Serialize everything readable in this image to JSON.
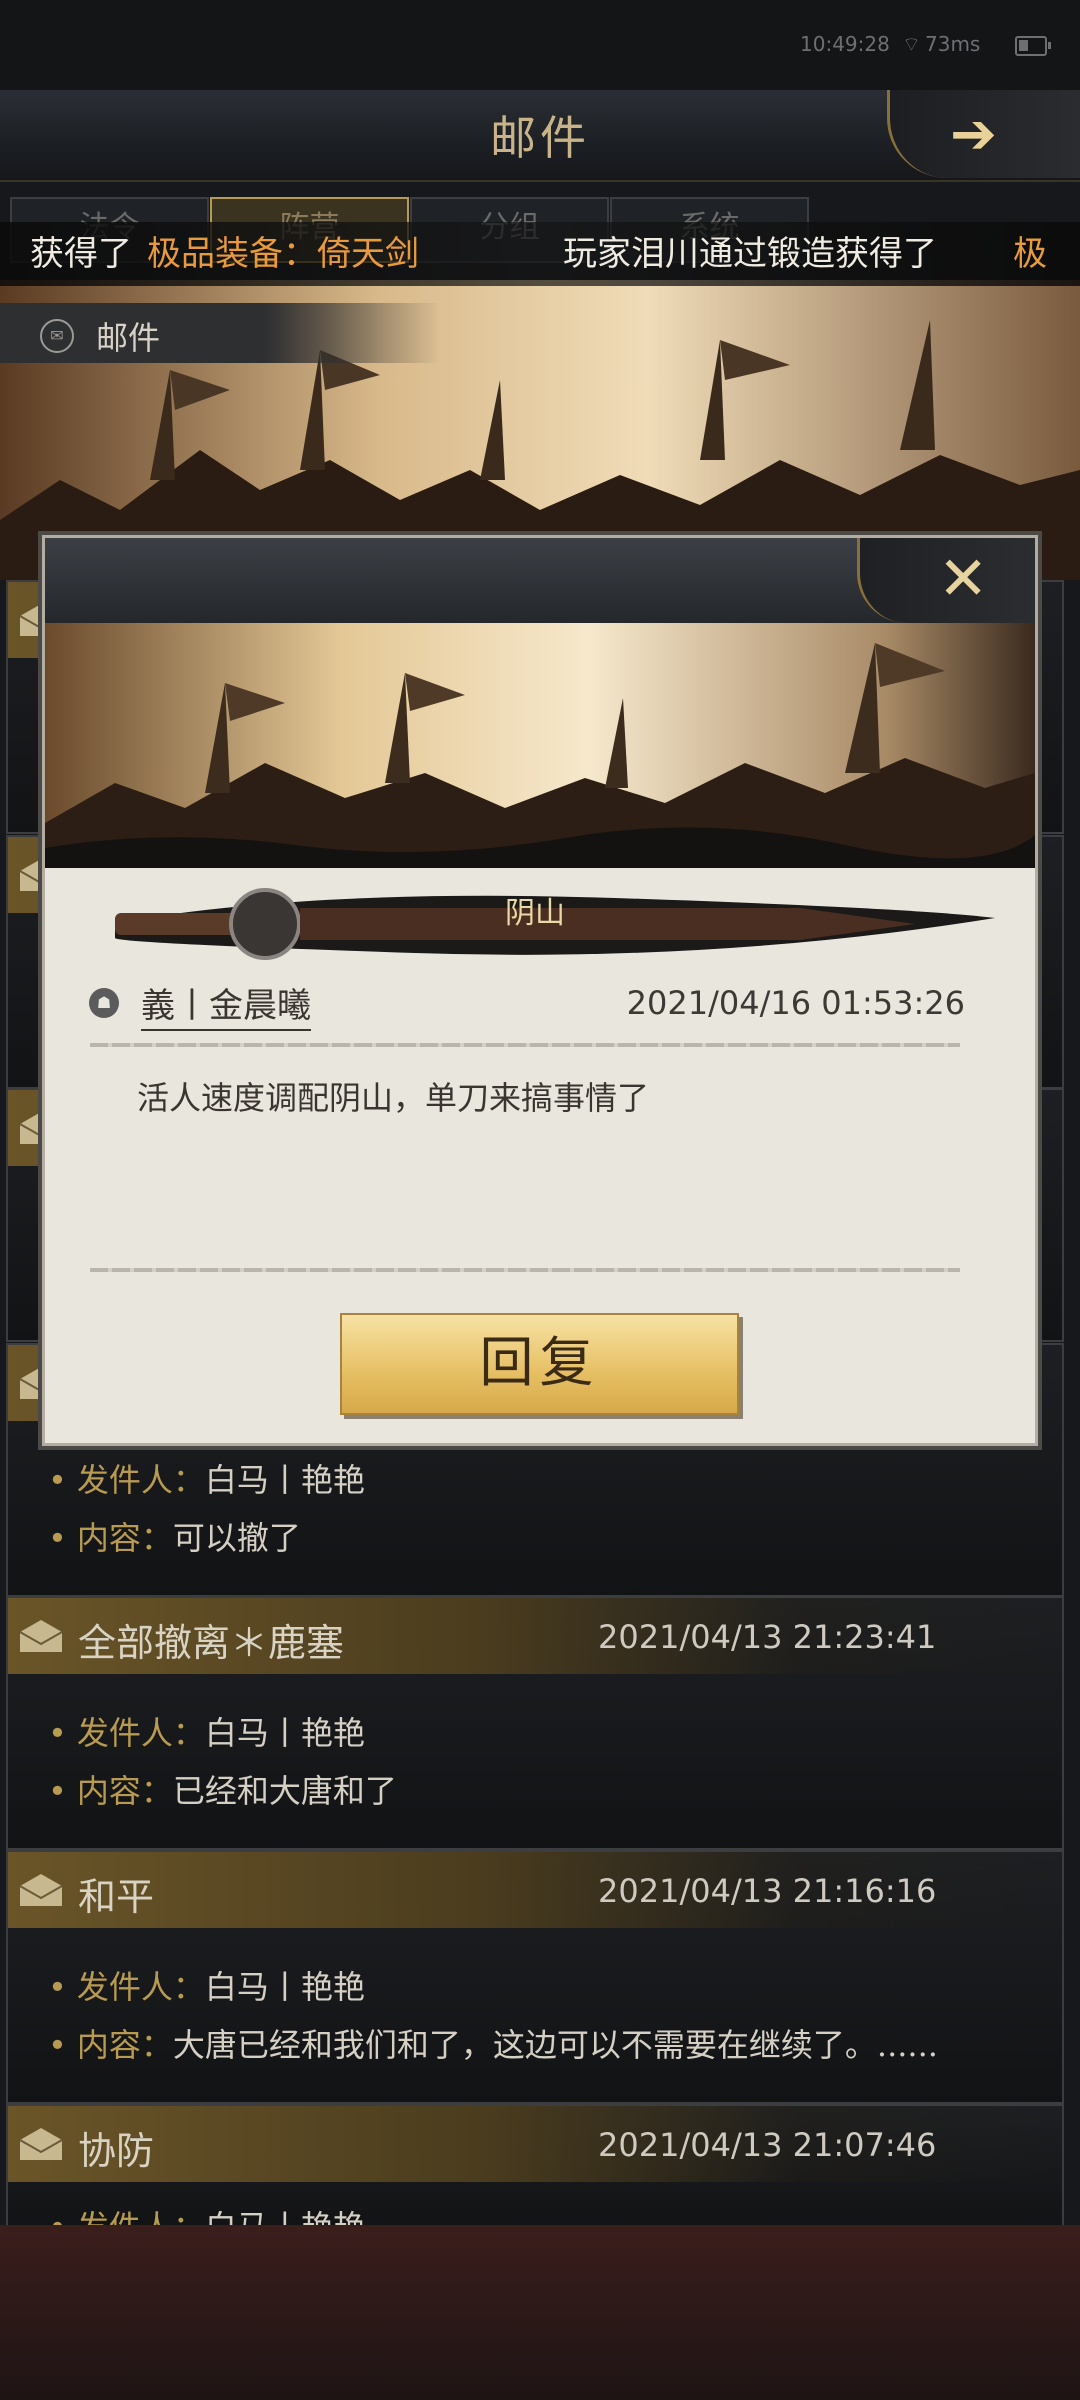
{
  "status_bar": {
    "time": "10:49:28",
    "latency": "73ms"
  },
  "header": {
    "title": "邮件"
  },
  "tabs": [
    {
      "label": "法令"
    },
    {
      "label": "阵营"
    },
    {
      "label": "分组"
    },
    {
      "label": "系统"
    }
  ],
  "marquee": {
    "part1": "获得了",
    "part2": "极品装备：倚天剑",
    "part3": "玩家泪川通过锻造获得了",
    "part4": "极"
  },
  "mail_section": {
    "label": "邮件"
  },
  "mail_list": {
    "sender_key": "发件人：",
    "content_key": "内容：",
    "items": [
      {
        "title": "",
        "date": "",
        "sender": "白马丨艳艳",
        "content": "可以撤了"
      },
      {
        "title": "全部撤离＊鹿塞",
        "date": "2021/04/13 21:23:41",
        "sender": "白马丨艳艳",
        "content": "已经和大唐和了"
      },
      {
        "title": "和平",
        "date": "2021/04/13 21:16:16",
        "sender": "白马丨艳艳",
        "content": "大唐已经和我们和了，这边可以不需要在继续了。......"
      },
      {
        "title": "协防",
        "date": "2021/04/13 21:07:46",
        "sender": "白马丨艳艳",
        "content": ""
      }
    ]
  },
  "modal": {
    "sword_label": "阴山",
    "sender": "義丨金晨曦",
    "date": "2021/04/16 01:53:26",
    "content": "活人速度调配阴山，单刀来搞事情了",
    "reply_label": "回复"
  },
  "colors": {
    "gold": "#b89a50",
    "marquee_highlight": "#e89a3c",
    "modal_bg": "#e9e6de"
  }
}
